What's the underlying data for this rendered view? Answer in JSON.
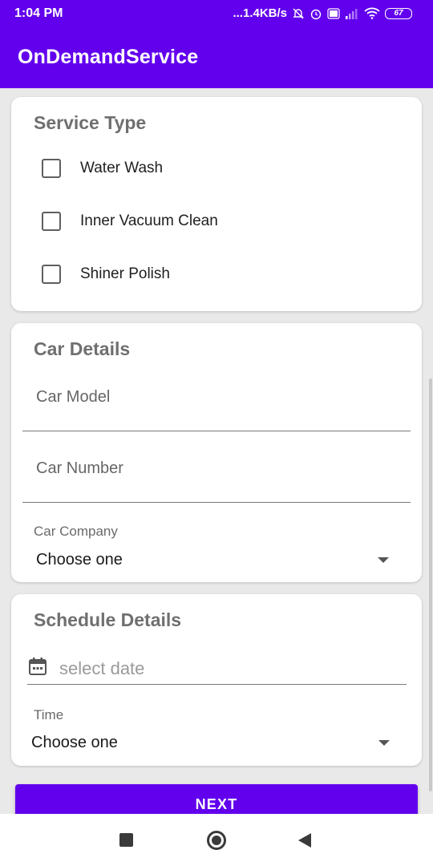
{
  "status_bar": {
    "time": "1:04 PM",
    "network_speed": "...1.4KB/s",
    "battery": "67",
    "icons": [
      "alarm-off-icon",
      "alarm-icon",
      "volte-icon",
      "signal-icon",
      "wifi-icon",
      "battery-icon"
    ]
  },
  "app_bar": {
    "title": "OnDemandService"
  },
  "service_type": {
    "title": "Service Type",
    "options": [
      {
        "label": "Water Wash",
        "checked": false
      },
      {
        "label": "Inner Vacuum Clean",
        "checked": false
      },
      {
        "label": "Shiner Polish",
        "checked": false
      }
    ]
  },
  "car_details": {
    "title": "Car Details",
    "car_model_placeholder": "Car Model",
    "car_number_placeholder": "Car Number",
    "car_company_label": "Car Company",
    "car_company_value": "Choose one"
  },
  "schedule_details": {
    "title": "Schedule Details",
    "date_placeholder": "select date",
    "time_label": "Time",
    "time_value": "Choose one"
  },
  "actions": {
    "next_label": "NEXT"
  },
  "colors": {
    "primary": "#6200ee",
    "background": "#e9e9e9",
    "card": "#ffffff"
  }
}
